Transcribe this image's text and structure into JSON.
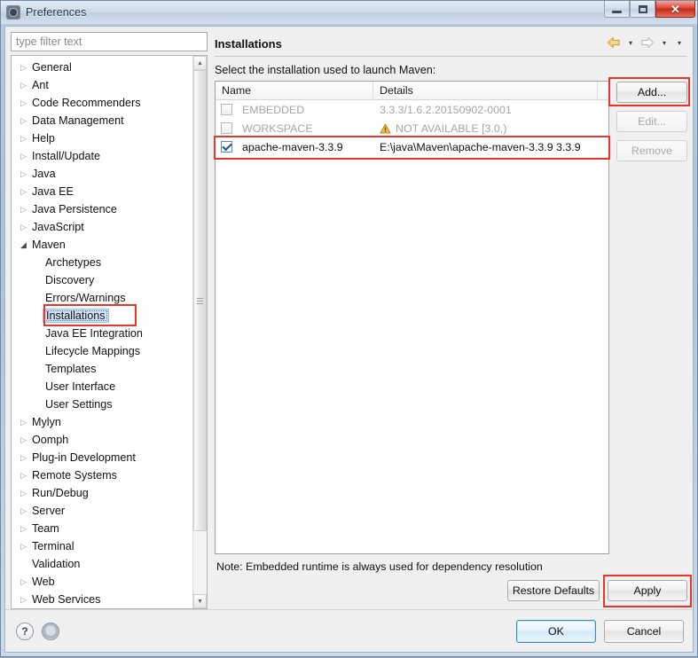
{
  "window": {
    "title": "Preferences",
    "icon": "preferences-gear-icon",
    "controls": {
      "minimize": "minimize-icon",
      "maximize": "maximize-icon",
      "close": "✕"
    }
  },
  "filter": {
    "placeholder": "type filter text",
    "value": ""
  },
  "tree": {
    "items": [
      {
        "label": "General",
        "level": 0,
        "state": "collapsed"
      },
      {
        "label": "Ant",
        "level": 0,
        "state": "collapsed"
      },
      {
        "label": "Code Recommenders",
        "level": 0,
        "state": "collapsed"
      },
      {
        "label": "Data Management",
        "level": 0,
        "state": "collapsed"
      },
      {
        "label": "Help",
        "level": 0,
        "state": "collapsed"
      },
      {
        "label": "Install/Update",
        "level": 0,
        "state": "collapsed"
      },
      {
        "label": "Java",
        "level": 0,
        "state": "collapsed"
      },
      {
        "label": "Java EE",
        "level": 0,
        "state": "collapsed"
      },
      {
        "label": "Java Persistence",
        "level": 0,
        "state": "collapsed"
      },
      {
        "label": "JavaScript",
        "level": 0,
        "state": "collapsed"
      },
      {
        "label": "Maven",
        "level": 0,
        "state": "expanded"
      },
      {
        "label": "Archetypes",
        "level": 1,
        "state": "leaf"
      },
      {
        "label": "Discovery",
        "level": 1,
        "state": "leaf"
      },
      {
        "label": "Errors/Warnings",
        "level": 1,
        "state": "leaf"
      },
      {
        "label": "Installations",
        "level": 1,
        "state": "leaf",
        "selected": true
      },
      {
        "label": "Java EE Integration",
        "level": 1,
        "state": "leaf"
      },
      {
        "label": "Lifecycle Mappings",
        "level": 1,
        "state": "leaf"
      },
      {
        "label": "Templates",
        "level": 1,
        "state": "leaf"
      },
      {
        "label": "User Interface",
        "level": 1,
        "state": "leaf"
      },
      {
        "label": "User Settings",
        "level": 1,
        "state": "leaf"
      },
      {
        "label": "Mylyn",
        "level": 0,
        "state": "collapsed"
      },
      {
        "label": "Oomph",
        "level": 0,
        "state": "collapsed"
      },
      {
        "label": "Plug-in Development",
        "level": 0,
        "state": "collapsed"
      },
      {
        "label": "Remote Systems",
        "level": 0,
        "state": "collapsed"
      },
      {
        "label": "Run/Debug",
        "level": 0,
        "state": "collapsed"
      },
      {
        "label": "Server",
        "level": 0,
        "state": "collapsed"
      },
      {
        "label": "Team",
        "level": 0,
        "state": "collapsed"
      },
      {
        "label": "Terminal",
        "level": 0,
        "state": "collapsed"
      },
      {
        "label": "Validation",
        "level": 0,
        "state": "leaf"
      },
      {
        "label": "Web",
        "level": 0,
        "state": "collapsed"
      },
      {
        "label": "Web Services",
        "level": 0,
        "state": "collapsed"
      }
    ],
    "collapsed_glyph": "▷",
    "expanded_glyph": "◢",
    "scrollbar": {
      "up_glyph": "▲",
      "down_glyph": "▼"
    }
  },
  "page": {
    "title": "Installations",
    "nav": {
      "back_icon": "back-arrow-icon",
      "back_menu_glyph": "▾",
      "forward_icon": "forward-arrow-icon",
      "forward_menu_glyph": "▾",
      "view_menu_glyph": "▾"
    },
    "instruction": "Select the installation used to launch Maven:",
    "table": {
      "columns": [
        "Name",
        "Details"
      ],
      "rows": [
        {
          "checked": false,
          "enabled": false,
          "name": "EMBEDDED",
          "details": "3.3.3/1.6.2.20150902-0001",
          "warning": false
        },
        {
          "checked": false,
          "enabled": false,
          "name": "WORKSPACE",
          "details": "NOT AVAILABLE [3.0,)",
          "warning": true,
          "warning_icon": "warning-triangle-icon"
        },
        {
          "checked": true,
          "enabled": true,
          "name": "apache-maven-3.3.9",
          "details": "E:\\java\\Maven\\apache-maven-3.3.9 3.3.9",
          "warning": false
        }
      ]
    },
    "side_buttons": [
      {
        "label": "Add...",
        "enabled": true
      },
      {
        "label": "Edit...",
        "enabled": false
      },
      {
        "label": "Remove",
        "enabled": false
      }
    ],
    "note": "Note: Embedded runtime is always used for dependency resolution",
    "restore_defaults_label": "Restore Defaults",
    "apply_label": "Apply"
  },
  "footer": {
    "help_icon": "?",
    "help_icon_name": "help-icon",
    "globe_icon": "⊕",
    "globe_icon_name": "globe-icon",
    "ok_label": "OK",
    "cancel_label": "Cancel"
  },
  "annotations": {
    "highlight_color": "#e8372a",
    "boxes": [
      "add-button",
      "selected-table-row",
      "installations-tree-item",
      "apply-button"
    ]
  }
}
